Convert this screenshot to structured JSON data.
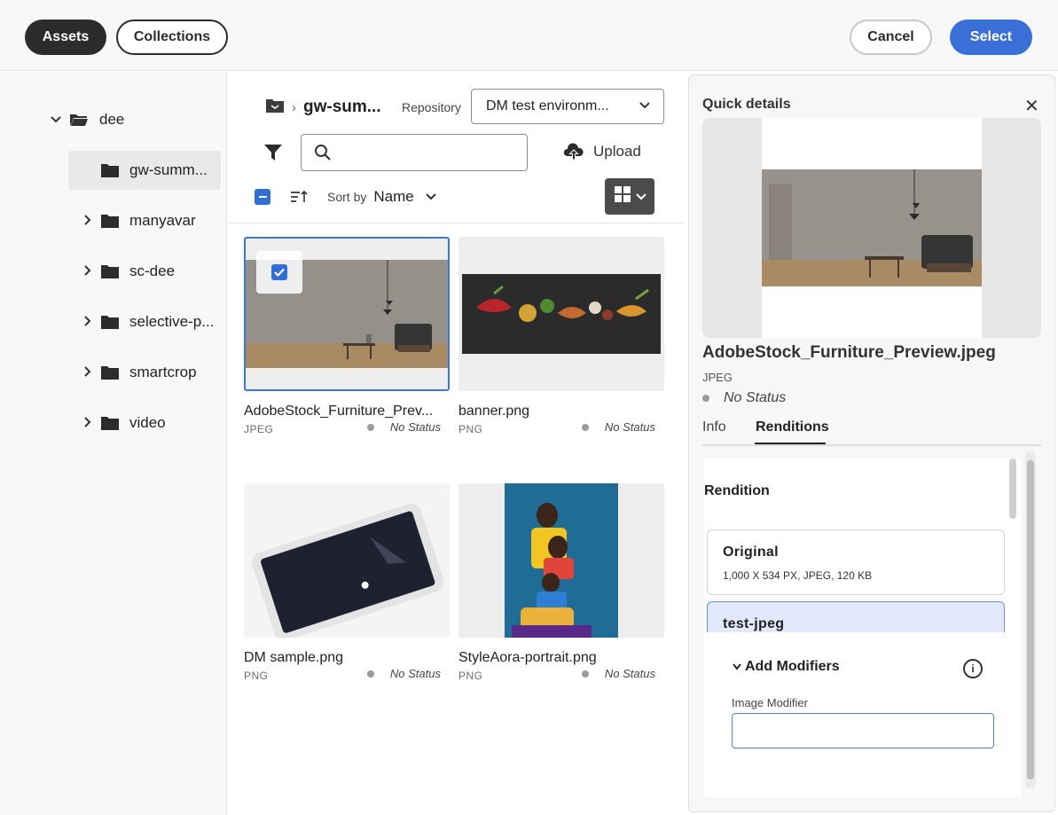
{
  "header": {
    "tab_assets": "Assets",
    "tab_collections": "Collections",
    "cancel_label": "Cancel",
    "select_label": "Select"
  },
  "tree": {
    "root": "dee",
    "items": [
      {
        "label": "gw-summ...",
        "selected": true
      },
      {
        "label": "manyavar"
      },
      {
        "label": "sc-dee"
      },
      {
        "label": "selective-p..."
      },
      {
        "label": "smartcrop"
      },
      {
        "label": "video"
      }
    ]
  },
  "browser": {
    "breadcrumb_current": "gw-sum...",
    "repository_label": "Repository",
    "repository_value": "DM test environm...",
    "search_placeholder": "",
    "upload_label": "Upload",
    "sort_by_label": "Sort by",
    "sort_value": "Name",
    "assets": [
      {
        "name": "AdobeStock_Furniture_Prev...",
        "type": "JPEG",
        "status": "No Status",
        "selected": true
      },
      {
        "name": "banner.png",
        "type": "PNG",
        "status": "No Status"
      },
      {
        "name": "DM sample.png",
        "type": "PNG",
        "status": "No Status"
      },
      {
        "name": "StyleAora-portrait.png",
        "type": "PNG",
        "status": "No Status"
      }
    ]
  },
  "quick_details": {
    "title": "Quick details",
    "file_name": "AdobeStock_Furniture_Preview.jpeg",
    "file_type": "JPEG",
    "status": "No Status",
    "tabs": [
      "Info",
      "Renditions"
    ],
    "active_tab": "Renditions",
    "rendition_heading": "Rendition",
    "renditions": [
      {
        "name": "Original",
        "detail": "1,000 X 534 PX, JPEG, 120 KB"
      },
      {
        "name": "test-jpeg"
      }
    ],
    "add_modifiers_label": "Add Modifiers",
    "image_modifier_label": "Image Modifier",
    "image_modifier_value": ""
  },
  "colors": {
    "accent": "#3a6fd8",
    "dark_pill": "#2c2c2c"
  }
}
